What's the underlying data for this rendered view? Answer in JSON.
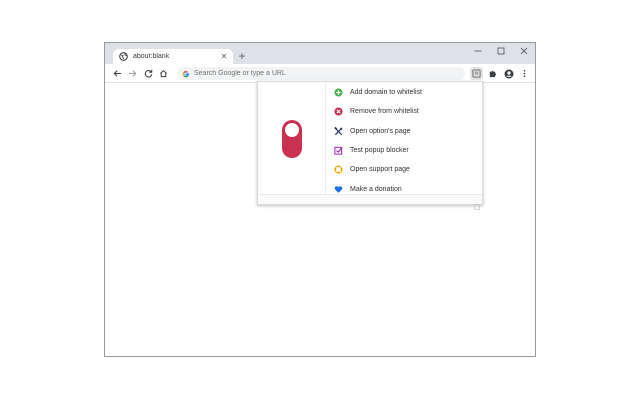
{
  "browser": {
    "tab": {
      "title": "about:blank",
      "favicon": "globe-icon",
      "close_icon": "close-icon"
    },
    "new_tab_icon": "plus-icon",
    "window_controls": [
      "minimize-icon",
      "maximize-icon",
      "close-icon"
    ],
    "nav": [
      "back-arrow-icon",
      "forward-arrow-icon",
      "reload-icon",
      "home-icon"
    ],
    "omnibox": {
      "placeholder": "Search Google or type a URL",
      "value": ""
    },
    "toolbar_icons": [
      "extension-popup-icon",
      "puzzle-icon",
      "account-icon",
      "kebab-menu-icon"
    ]
  },
  "popup": {
    "toggle": {
      "state": "off",
      "color": "#c8314f"
    },
    "menu": [
      {
        "label": "Add domain to whitelist",
        "icon": "plus-circle-icon",
        "color": "#4caf50"
      },
      {
        "label": "Remove from whitelist",
        "icon": "x-circle-icon",
        "color": "#c8314f"
      },
      {
        "label": "Open option's page",
        "icon": "tools-icon",
        "color": "#2b3a67"
      },
      {
        "label": "Test popup blocker",
        "icon": "checkbox-icon",
        "color": "#9c27b0"
      },
      {
        "label": "Open support page",
        "icon": "lifebuoy-icon",
        "color": "#f5a300"
      },
      {
        "label": "Make a donation",
        "icon": "heart-icon",
        "color": "#1a73e8"
      }
    ]
  }
}
